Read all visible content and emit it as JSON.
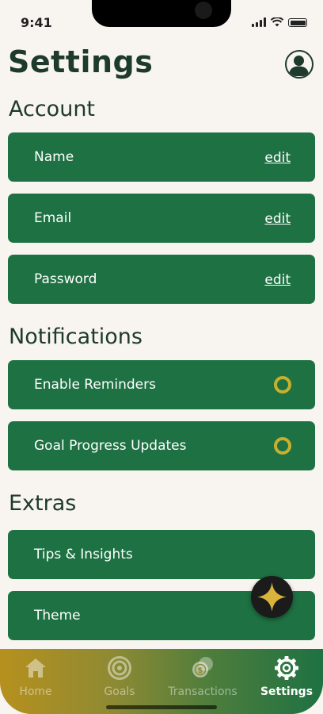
{
  "status_bar": {
    "time": "9:41"
  },
  "header": {
    "title": "Settings",
    "profile_icon": "user-icon"
  },
  "sections": {
    "account": {
      "title": "Account",
      "items": [
        {
          "label": "Name",
          "action": "edit"
        },
        {
          "label": "Email",
          "action": "edit"
        },
        {
          "label": "Password",
          "action": "edit"
        }
      ]
    },
    "notifications": {
      "title": "Notifications",
      "items": [
        {
          "label": "Enable Reminders",
          "toggle_on": false
        },
        {
          "label": "Goal Progress Updates",
          "toggle_on": false
        }
      ]
    },
    "extras": {
      "title": "Extras",
      "items": [
        {
          "label": "Tips & Insights"
        },
        {
          "label": "Theme"
        }
      ]
    }
  },
  "fab": {
    "icon": "sparkle-icon"
  },
  "tabbar": {
    "tabs": [
      {
        "label": "Home",
        "icon": "home-icon",
        "active": false
      },
      {
        "label": "Goals",
        "icon": "target-icon",
        "active": false
      },
      {
        "label": "Transactions",
        "icon": "coins-icon",
        "active": false
      },
      {
        "label": "Settings",
        "icon": "gear-icon",
        "active": true
      }
    ]
  },
  "colors": {
    "background": "#F8F5F0",
    "primary_green": "#1E7143",
    "dark_text": "#1E3A2C",
    "toggle_gold": "#C8B02E",
    "tabbar_gold": "#B6901E"
  }
}
